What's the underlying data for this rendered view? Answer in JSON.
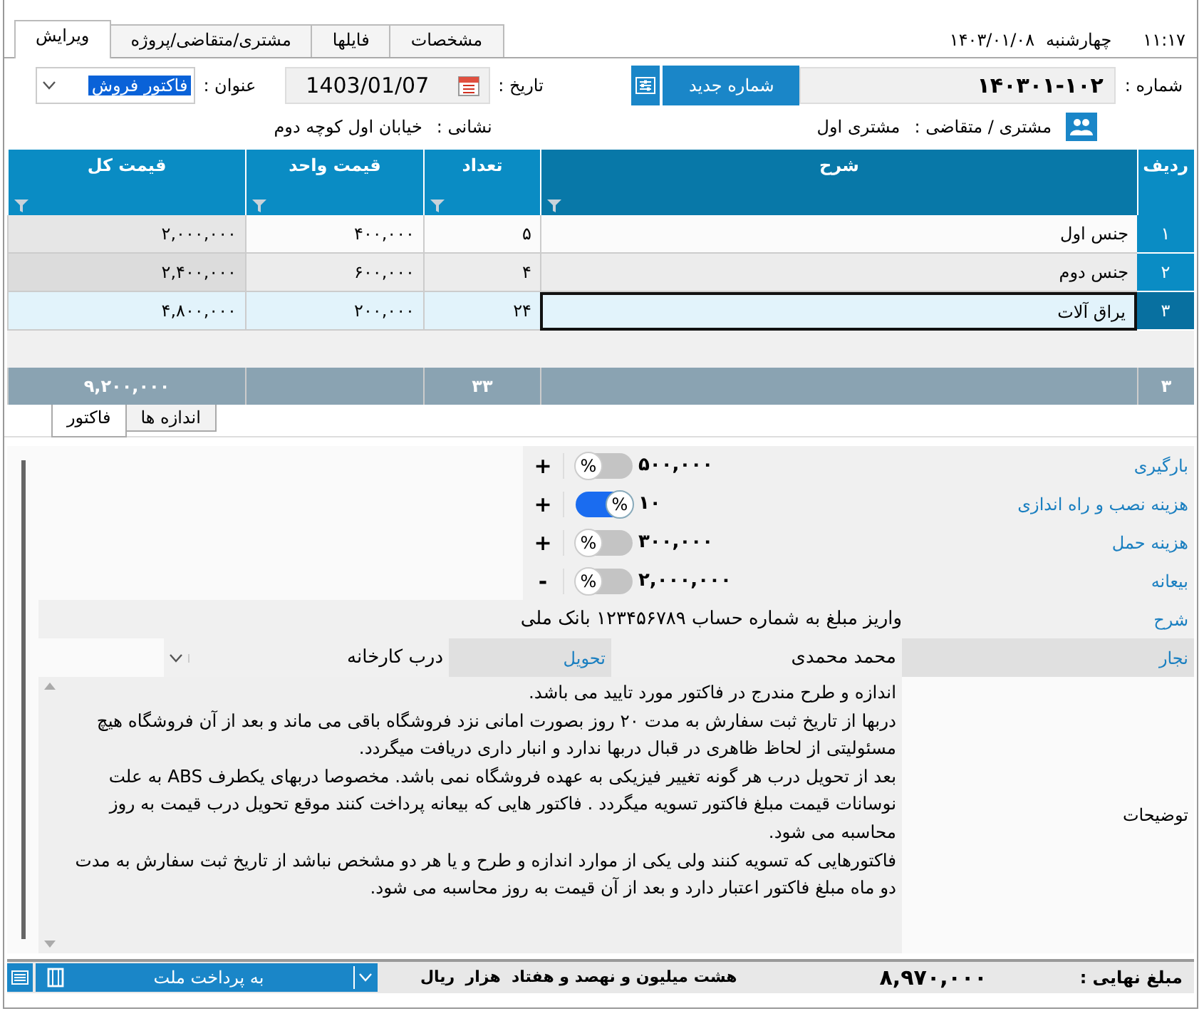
{
  "tabs": [
    {
      "label": "مشخصات",
      "selected": false
    },
    {
      "label": "فایلها",
      "selected": false
    },
    {
      "label": "مشتری/متقاضی/پروژه",
      "selected": false
    },
    {
      "label": "ویرایش",
      "selected": true
    }
  ],
  "clock": {
    "time": "۱۱:۱۷",
    "weekday": "چهارشنبه",
    "date": "۱۴۰۳/۰۱/۰۸"
  },
  "form": {
    "number_label": "شماره :",
    "number": "۱۴۰۳۰۱-۱۰۲",
    "new_number_button": "شماره جدید",
    "date_label": "تاریخ :",
    "date": "1403/01/07",
    "title_label": "عنوان :",
    "title": "فاکتور فروش",
    "customer_label": "مشتری / متقاضی :",
    "customer": "مشتری اول",
    "address_label": "نشانی :",
    "address": "خیابان اول کوچه دوم"
  },
  "table": {
    "columns": [
      {
        "label": "ردیف",
        "filterable": false
      },
      {
        "label": "شرح",
        "filterable": true
      },
      {
        "label": "تعداد",
        "filterable": true
      },
      {
        "label": "قیمت واحد",
        "filterable": true
      },
      {
        "label": "قیمت کل",
        "filterable": true
      }
    ],
    "rows": [
      {
        "index": "۱",
        "description": "جنس اول",
        "quantity": "۵",
        "unit_price": "۴۰۰,۰۰۰",
        "total": "۲,۰۰۰,۰۰۰",
        "selected": false
      },
      {
        "index": "۲",
        "description": "جنس دوم",
        "quantity": "۴",
        "unit_price": "۶۰۰,۰۰۰",
        "total": "۲,۴۰۰,۰۰۰",
        "selected": false
      },
      {
        "index": "۳",
        "description": "یراق آلات",
        "quantity": "۲۴",
        "unit_price": "۲۰۰,۰۰۰",
        "total": "۴,۸۰۰,۰۰۰",
        "selected": true
      }
    ],
    "totals": {
      "count": "۳",
      "quantity": "۳۳",
      "total": "۹,۲۰۰,۰۰۰"
    }
  },
  "sub_tabs": [
    {
      "label": "اندازه ها",
      "selected": false
    },
    {
      "label": "فاکتور",
      "selected": true
    }
  ],
  "charges": [
    {
      "label": "بارگیری",
      "value": "۵۰۰,۰۰۰",
      "toggle_label": "%",
      "percent": false,
      "sign": "+"
    },
    {
      "label": "هزینه نصب و راه اندازی",
      "value": "۱۰",
      "toggle_label": "%",
      "percent": true,
      "sign": "+"
    },
    {
      "label": "هزینه حمل",
      "value": "۳۰۰,۰۰۰",
      "toggle_label": "%",
      "percent": false,
      "sign": "+"
    },
    {
      "label": "بیعانه",
      "value": "۲,۰۰۰,۰۰۰",
      "toggle_label": "%",
      "percent": false,
      "sign": "-"
    }
  ],
  "note": {
    "label": "شرح",
    "value": "واریز مبلغ به شماره حساب ۱۲۳۴۵۶۷۸۹ بانک ملی"
  },
  "carpenter": {
    "label": "نجار",
    "value": "محمد محمدی",
    "delivery_label": "تحویل",
    "delivery": "درب کارخانه"
  },
  "remarks": {
    "label": "توضیحات",
    "paragraphs": [
      "اندازه و طرح مندرج در فاکتور مورد تایید می باشد.",
      "دربها از تاریخ ثبت سفارش به مدت ۲۰ روز بصورت امانی نزد فروشگاه باقی می ماند و بعد از آن فروشگاه هیچ مسئولیتی از لحاظ ظاهری در قبال دربها ندارد و انبار داری دریافت میگردد.",
      "بعد از تحویل درب هر گونه تغییر فیزیکی به عهده فروشگاه نمی باشد. مخصوصا دربهای یکطرف ABS به علت نوسانات قیمت مبلغ فاکتور تسویه میگردد . فاکتور هایی که بیعانه پرداخت کنند موقع تحویل درب قیمت به روز محاسبه می شود.",
      "فاکتورهایی که تسویه کنند ولی یکی از موارد اندازه و طرح و یا هر دو مشخص نباشد از تاریخ ثبت سفارش به مدت دو ماه مبلغ فاکتور اعتبار دارد و بعد از آن قیمت به روز محاسبه می شود."
    ]
  },
  "footer": {
    "payment": "به پرداخت ملت",
    "amount_words": "هشت میلیون و نهصد و هفتاد  هزار  ریال",
    "amount": "۸,۹۷۰,۰۰۰",
    "final_label": "مبلغ نهایی :"
  }
}
